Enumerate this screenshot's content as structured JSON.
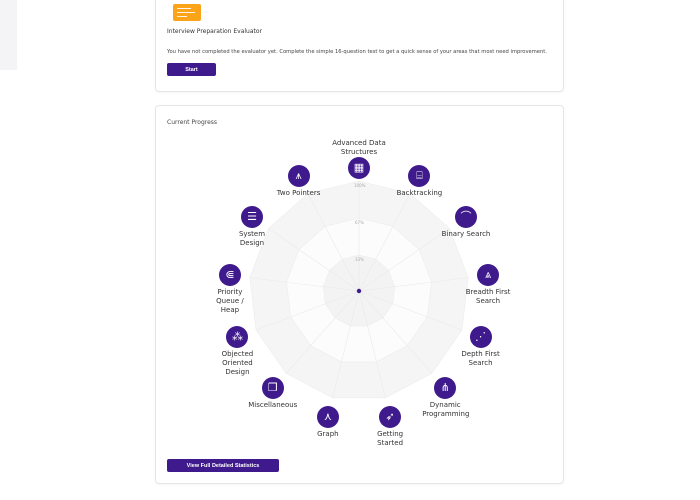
{
  "evaluator": {
    "title": "Interview Preparation Evaluator",
    "description": "You have not completed the evaluator yet. Complete the simple 16-question test to get a quick sense of your areas that most need improvement.",
    "start_label": "Start"
  },
  "progress": {
    "title": "Current Progress",
    "ring_labels": [
      "100%",
      "67%",
      "33%"
    ],
    "topics": [
      {
        "label": "Advanced Data Structures",
        "icon": "grid-blocks-icon",
        "glyph": "▦"
      },
      {
        "label": "Backtracking",
        "icon": "maze-icon",
        "glyph": "⌸"
      },
      {
        "label": "Binary Search",
        "icon": "binary-search-icon",
        "glyph": "⌒"
      },
      {
        "label": "Breadth First Search",
        "icon": "layers-icon",
        "glyph": "⩓"
      },
      {
        "label": "Depth First Search",
        "icon": "path-icon",
        "glyph": "⋰"
      },
      {
        "label": "Dynamic Programming",
        "icon": "tree-icon",
        "glyph": "⋔"
      },
      {
        "label": "Getting Started",
        "icon": "rocket-icon",
        "glyph": "➶"
      },
      {
        "label": "Graph",
        "icon": "graph-icon",
        "glyph": "⋏"
      },
      {
        "label": "Miscellaneous",
        "icon": "copy-squares-icon",
        "glyph": "❐"
      },
      {
        "label": "Objected Oriented Design",
        "icon": "hierarchy-icon",
        "glyph": "⁂"
      },
      {
        "label": "Priority Queue / Heap",
        "icon": "queue-icon",
        "glyph": "⋐"
      },
      {
        "label": "System Design",
        "icon": "database-icon",
        "glyph": "☰"
      },
      {
        "label": "Two Pointers",
        "icon": "two-pointers-icon",
        "glyph": "⩚"
      }
    ],
    "values": [
      0,
      0,
      0,
      0,
      0,
      0,
      0,
      0,
      0,
      0,
      0,
      0,
      0
    ],
    "stats_label": "View Full Detailed Statistics"
  },
  "colors": {
    "accent": "#3f1a8c",
    "illustration": "#fba41a"
  }
}
